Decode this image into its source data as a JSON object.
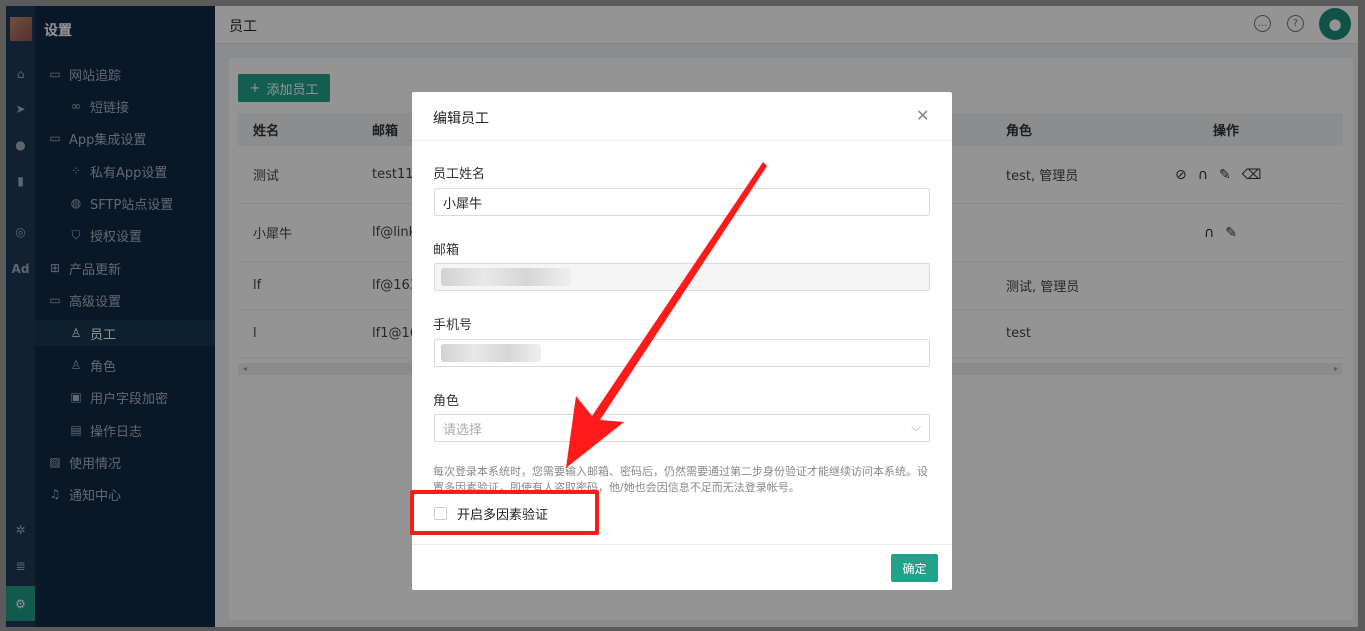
{
  "sidebar": {
    "title": "设置",
    "items": [
      {
        "label": "网站追踪",
        "icon": "folder-icon"
      },
      {
        "label": "短链接",
        "icon": "link-icon"
      },
      {
        "label": "App集成设置",
        "icon": "folder-icon"
      },
      {
        "label": "私有App设置",
        "icon": "grid-icon"
      },
      {
        "label": "SFTP站点设置",
        "icon": "globe-icon"
      },
      {
        "label": "授权设置",
        "icon": "shield-icon"
      },
      {
        "label": "产品更新",
        "icon": "apps-icon"
      },
      {
        "label": "高级设置",
        "icon": "folder-icon"
      },
      {
        "label": "员工",
        "icon": "user-icon"
      },
      {
        "label": "角色",
        "icon": "role-icon"
      },
      {
        "label": "用户字段加密",
        "icon": "encrypt-icon"
      },
      {
        "label": "操作日志",
        "icon": "log-icon"
      },
      {
        "label": "使用情况",
        "icon": "usage-icon"
      },
      {
        "label": "通知中心",
        "icon": "bell-icon"
      }
    ],
    "rail_label": "Ad"
  },
  "header": {
    "title": "员工"
  },
  "toolbar": {
    "add_label": "添加员工"
  },
  "table": {
    "columns": {
      "name": "姓名",
      "email": "邮箱",
      "role": "角色",
      "ops": "操作"
    },
    "rows": [
      {
        "name": "测试",
        "email": "test11@",
        "role": "test, 管理员"
      },
      {
        "name": "小犀牛",
        "email": "lf@link",
        "role": ""
      },
      {
        "name": "lf",
        "email": "lf@163.",
        "role": "测试, 管理员"
      },
      {
        "name": "l",
        "email": "lf1@16",
        "role": "test"
      }
    ]
  },
  "modal": {
    "title": "编辑员工",
    "name_label": "员工姓名",
    "name_value": "小犀牛",
    "email_label": "邮箱",
    "phone_label": "手机号",
    "role_label": "角色",
    "role_placeholder": "请选择",
    "hint": "每次登录本系统时，您需要输入邮箱、密码后，仍然需要通过第二步身份验证才能继续访问本系统。设置多因素验证，即使有人盗取密码，他/她也会因信息不足而无法登录帐号。",
    "mfa_label": "开启多因素验证",
    "mfa_checked": false,
    "ok_label": "确定"
  },
  "colors": {
    "accent": "#21a38b",
    "annotation": "#ff1a1a",
    "sidebar": "#0e2a46"
  }
}
